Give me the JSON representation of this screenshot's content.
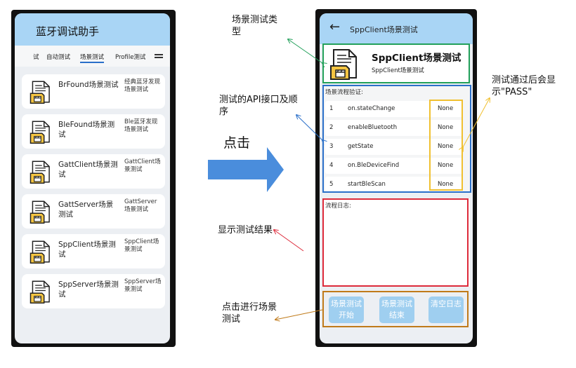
{
  "phone1": {
    "title": "蓝牙调试助手",
    "tabs": [
      {
        "label": "试",
        "active": false
      },
      {
        "label": "自动测试",
        "active": false
      },
      {
        "label": "场景测试",
        "active": true
      },
      {
        "label": "Profile测试",
        "active": false
      }
    ],
    "cards": [
      {
        "name": "BrFound场景测试",
        "desc": "经典蓝牙发现场景测试"
      },
      {
        "name": "BleFound场景测试",
        "desc": "Ble蓝牙发现场景测试"
      },
      {
        "name": "GattClient场景测试",
        "desc": "GattClient场景测试"
      },
      {
        "name": "GattServer场景测试",
        "desc": "GattServer场景测试"
      },
      {
        "name": "SppClient场景测试",
        "desc": "SppClient场景测试"
      },
      {
        "name": "SppServer场景测试",
        "desc": "SppServer场景测试"
      }
    ]
  },
  "phone2": {
    "back_icon": "←",
    "title": "SppClient场景测试",
    "info_title": "SppClient场景测试",
    "info_subtitle": "SppClient场景测试",
    "steps_label": "场景流程验证:",
    "steps": [
      {
        "no": "1",
        "api": "on.stateChange",
        "result": "None"
      },
      {
        "no": "2",
        "api": "enableBluetooth",
        "result": "None"
      },
      {
        "no": "3",
        "api": "getState",
        "result": "None"
      },
      {
        "no": "4",
        "api": "on.BleDeviceFind",
        "result": "None"
      },
      {
        "no": "5",
        "api": "startBleScan",
        "result": "None"
      }
    ],
    "log_label": "流程日志:",
    "buttons": [
      "场景测试开始",
      "场景测试结束",
      "清空日志"
    ]
  },
  "annotations": {
    "scene_type": "场景测试类型",
    "api_order": "测试的API接口及顺序",
    "click": "点击",
    "show_result": "显示测试结果",
    "click_run": "点击进行场景测试",
    "pass_note": "测试通过后会显示\"PASS\""
  },
  "colors": {
    "header": "#a9d5f5",
    "green_box": "#22a05a",
    "blue_box": "#2a6fc9",
    "yellow_box": "#f0c030",
    "red_box": "#dd2a3a",
    "orange_box": "#c07a1a",
    "big_arrow": "#4a8ddc"
  }
}
